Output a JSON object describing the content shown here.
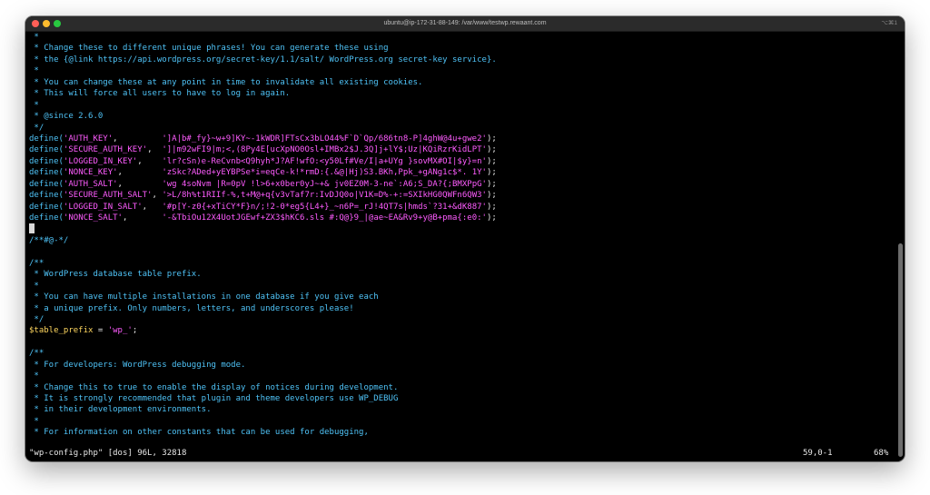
{
  "window": {
    "title": "ubuntu@ip-172-31-88-149: /var/www/testwp.rewaant.com",
    "shortcut": "⌥⌘1"
  },
  "lines": [
    [
      {
        "c": "c-comment",
        "t": " *"
      }
    ],
    [
      {
        "c": "c-comment",
        "t": " * Change these to different unique phrases! You can generate these using"
      }
    ],
    [
      {
        "c": "c-comment",
        "t": " * the {@link https://api.wordpress.org/secret-key/1.1/salt/ WordPress.org secret-key service}."
      }
    ],
    [
      {
        "c": "c-comment",
        "t": " *"
      }
    ],
    [
      {
        "c": "c-comment",
        "t": " * You can change these at any point in time to invalidate all existing cookies."
      }
    ],
    [
      {
        "c": "c-comment",
        "t": " * This will force all users to have to log in again."
      }
    ],
    [
      {
        "c": "c-comment",
        "t": " *"
      }
    ],
    [
      {
        "c": "c-comment",
        "t": " * @since 2.6.0"
      }
    ],
    [
      {
        "c": "c-comment",
        "t": " */"
      }
    ],
    [
      {
        "c": "c-define",
        "t": "define("
      },
      {
        "c": "c-string",
        "t": "'AUTH_KEY'"
      },
      {
        "c": "c-plain",
        "t": ",         "
      },
      {
        "c": "c-string",
        "t": "']A|b#_fy}~w+9]KY~-1kWDR]FTsCx3bLO44%F`D`Qp/686tn8-P]4ghW@4u+gwe2'"
      },
      {
        "c": "c-plain",
        "t": ");"
      }
    ],
    [
      {
        "c": "c-define",
        "t": "define("
      },
      {
        "c": "c-string",
        "t": "'SECURE_AUTH_KEY'"
      },
      {
        "c": "c-plain",
        "t": ",  "
      },
      {
        "c": "c-string",
        "t": "']|m92wFI9|m;<,(8Py4E[ucXpNO0Osl+IMBx2$J.3Q]j+lY$;Uz|KQiRzrKidLPT'"
      },
      {
        "c": "c-plain",
        "t": ");"
      }
    ],
    [
      {
        "c": "c-define",
        "t": "define("
      },
      {
        "c": "c-string",
        "t": "'LOGGED_IN_KEY'"
      },
      {
        "c": "c-plain",
        "t": ",    "
      },
      {
        "c": "c-string",
        "t": "'lr?cSn)e-ReCvnb<Q9hyh*J?AF!wfO:<y50Lf#Ve/I|a+UYg }sovMX#OI|$y}=n'"
      },
      {
        "c": "c-plain",
        "t": ");"
      }
    ],
    [
      {
        "c": "c-define",
        "t": "define("
      },
      {
        "c": "c-string",
        "t": "'NONCE_KEY'"
      },
      {
        "c": "c-plain",
        "t": ",        "
      },
      {
        "c": "c-string",
        "t": "'zSkc?ADed+yEYBPSe*i=eqCe-k!*rmD:{.&@|Hj)S3.BKh,Ppk_+gANg1c$*. 1Y'"
      },
      {
        "c": "c-plain",
        "t": ");"
      }
    ],
    [
      {
        "c": "c-define",
        "t": "define("
      },
      {
        "c": "c-string",
        "t": "'AUTH_SALT'"
      },
      {
        "c": "c-plain",
        "t": ",        "
      },
      {
        "c": "c-string",
        "t": "'wg 4soNvm |R=0pV !l>6+x0ber0yJ~+& jv0EZ0M-3-ne`:A6;S_DA?{;BMXPpG'"
      },
      {
        "c": "c-plain",
        "t": ");"
      }
    ],
    [
      {
        "c": "c-define",
        "t": "define("
      },
      {
        "c": "c-string",
        "t": "'SECURE_AUTH_SALT'"
      },
      {
        "c": "c-plain",
        "t": ", "
      },
      {
        "c": "c-string",
        "t": "'>L/8h%t1RIIf-%,t+M@+q{v3vTaf7r:IvDJQ0o|V1K=D%-+:=SXIkHG0QWFn6QW3'"
      },
      {
        "c": "c-plain",
        "t": ");"
      }
    ],
    [
      {
        "c": "c-define",
        "t": "define("
      },
      {
        "c": "c-string",
        "t": "'LOGGED_IN_SALT'"
      },
      {
        "c": "c-plain",
        "t": ",   "
      },
      {
        "c": "c-string",
        "t": "'#p[Y-z0{+xTiCY*F}n/;!2-0*eg5{L4+}_~n6P=_rJ!4QT7s|hmds`?31+&dK887'"
      },
      {
        "c": "c-plain",
        "t": ");"
      }
    ],
    [
      {
        "c": "c-define",
        "t": "define("
      },
      {
        "c": "c-string",
        "t": "'NONCE_SALT'"
      },
      {
        "c": "c-plain",
        "t": ",       "
      },
      {
        "c": "c-string",
        "t": "'-&TbiOu12X4UotJGEwf+ZX3$hKC6.sls #:Q@}9_|@ae~EA&Rv9+y@B+pma{:e0:'"
      },
      {
        "c": "c-plain",
        "t": ");"
      }
    ],
    [],
    [
      {
        "c": "c-comment",
        "t": "/**#@-*/"
      }
    ],
    [],
    [
      {
        "c": "c-comment",
        "t": "/**"
      }
    ],
    [
      {
        "c": "c-comment",
        "t": " * WordPress database table prefix."
      }
    ],
    [
      {
        "c": "c-comment",
        "t": " *"
      }
    ],
    [
      {
        "c": "c-comment",
        "t": " * You can have multiple installations in one database if you give each"
      }
    ],
    [
      {
        "c": "c-comment",
        "t": " * a unique prefix. Only numbers, letters, and underscores please!"
      }
    ],
    [
      {
        "c": "c-comment",
        "t": " */"
      }
    ],
    [
      {
        "c": "c-var",
        "t": "$table_prefix"
      },
      {
        "c": "c-plain",
        "t": " = "
      },
      {
        "c": "c-string",
        "t": "'wp_'"
      },
      {
        "c": "c-plain",
        "t": ";"
      }
    ],
    [],
    [
      {
        "c": "c-comment",
        "t": "/**"
      }
    ],
    [
      {
        "c": "c-comment",
        "t": " * For developers: WordPress debugging mode."
      }
    ],
    [
      {
        "c": "c-comment",
        "t": " *"
      }
    ],
    [
      {
        "c": "c-comment",
        "t": " * Change this to true to enable the display of notices during development."
      }
    ],
    [
      {
        "c": "c-comment",
        "t": " * It is strongly recommended that plugin and theme developers use WP_DEBUG"
      }
    ],
    [
      {
        "c": "c-comment",
        "t": " * in their development environments."
      }
    ],
    [
      {
        "c": "c-comment",
        "t": " *"
      }
    ],
    [
      {
        "c": "c-comment",
        "t": " * For information on other constants that can be used for debugging,"
      }
    ]
  ],
  "status": {
    "file": "\"wp-config.php\" [dos] 96L, 32818",
    "position": "59,0-1",
    "percent": "68%"
  }
}
